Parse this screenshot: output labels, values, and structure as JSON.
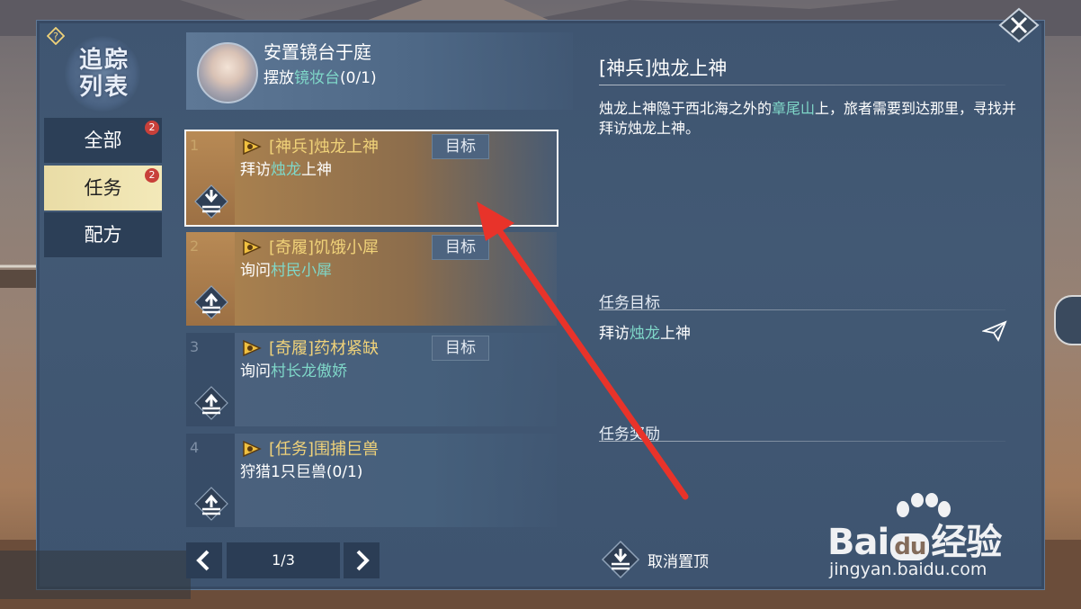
{
  "window": {
    "help_icon": "question-diamond-icon",
    "close_icon": "close-x-icon",
    "title": "追踪列表"
  },
  "sidebar": {
    "items": [
      {
        "label": "全部",
        "badge": "2",
        "active": false
      },
      {
        "label": "任务",
        "badge": "2",
        "active": true
      },
      {
        "label": "配方",
        "badge": "",
        "active": false
      }
    ]
  },
  "tracked": {
    "name": "安置镜台于庭",
    "sub_prefix": "摆放",
    "sub_highlight": "镜妆台",
    "sub_suffix": "(0/1)"
  },
  "quests": [
    {
      "num": "1",
      "title": "[神兵]烛龙上神",
      "desc_prefix": "拜访",
      "desc_highlight": "烛龙",
      "desc_suffix": "上神",
      "target_label": "目标",
      "pinned": true,
      "selected": true
    },
    {
      "num": "2",
      "title": "[奇履]饥饿小犀",
      "desc_prefix": "询问",
      "desc_highlight": "村民小犀",
      "desc_suffix": "",
      "target_label": "目标",
      "pinned": false,
      "selected": false
    },
    {
      "num": "3",
      "title": "[奇履]药材紧缺",
      "desc_prefix": "询问",
      "desc_highlight": "村长龙傲娇",
      "desc_suffix": "",
      "target_label": "目标",
      "pinned": false,
      "selected": false
    },
    {
      "num": "4",
      "title": "[任务]围捕巨兽",
      "desc_prefix": "狩猎1只巨兽(0/1)",
      "desc_highlight": "",
      "desc_suffix": "",
      "target_label": "",
      "pinned": false,
      "selected": false
    }
  ],
  "pager": {
    "page": "1/3"
  },
  "detail": {
    "title": "[神兵]烛龙上神",
    "desc_1": "烛龙上神隐于西北海之外的",
    "desc_highlight": "章尾山",
    "desc_2": "上，旅者需要到达那里，寻找并拜访烛龙上神。",
    "goal_heading": "任务目标",
    "goal_prefix": "拜访",
    "goal_highlight": "烛龙",
    "goal_suffix": "上神",
    "reward_heading": "任务奖励",
    "unpin_label": "取消置顶"
  },
  "watermark": {
    "main": "Bai",
    "paw": "du",
    "cn": "经验",
    "sub": "jingyan.baidu.com"
  },
  "colors": {
    "highlight": "#7fd7c8",
    "quest_title": "#f0d279",
    "active_tab": "#f3e9b9",
    "arrow": "#e8332a"
  }
}
